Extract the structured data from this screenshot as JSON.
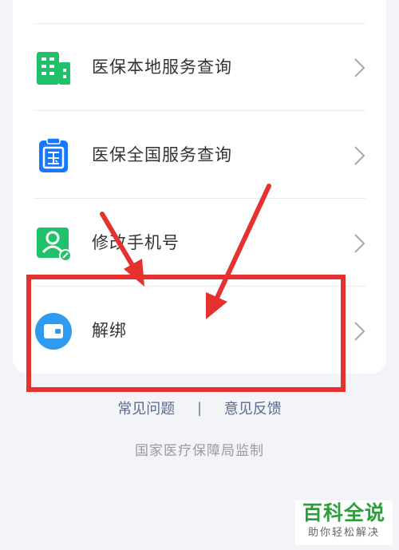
{
  "menu": {
    "items": [
      {
        "label": "医保本地服务查询",
        "icon": "building-icon"
      },
      {
        "label": "医保全国服务查询",
        "icon": "national-clipboard-icon"
      },
      {
        "label": "修改手机号",
        "icon": "user-edit-icon"
      },
      {
        "label": "解绑",
        "icon": "wallet-icon"
      }
    ]
  },
  "links": {
    "faq": "常见问题",
    "separator": "|",
    "feedback": "意见反馈"
  },
  "footer": {
    "supervision": "国家医疗保障局监制"
  },
  "watermark": {
    "title": "百科全说",
    "subtitle": "助你轻松解决"
  },
  "colors": {
    "green": "#1fc16b",
    "blue": "#1677ff",
    "annotation_red": "#e5312f",
    "link": "#596a8e"
  }
}
